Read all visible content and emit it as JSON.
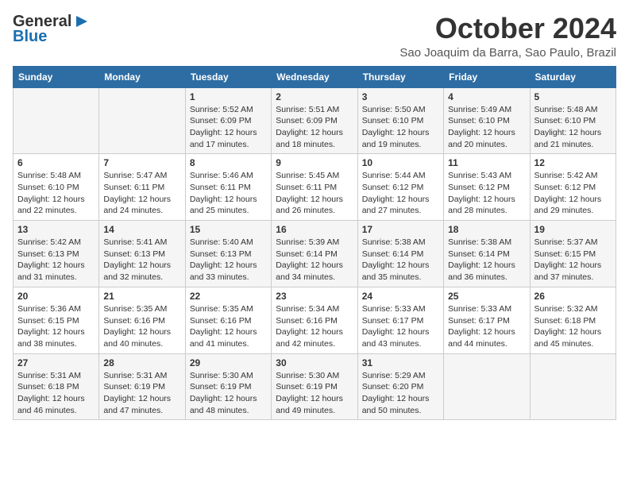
{
  "header": {
    "logo_line1": "General",
    "logo_line2": "Blue",
    "month_title": "October 2024",
    "location": "Sao Joaquim da Barra, Sao Paulo, Brazil"
  },
  "days_of_week": [
    "Sunday",
    "Monday",
    "Tuesday",
    "Wednesday",
    "Thursday",
    "Friday",
    "Saturday"
  ],
  "weeks": [
    [
      {
        "day": "",
        "sunrise": "",
        "sunset": "",
        "daylight": ""
      },
      {
        "day": "",
        "sunrise": "",
        "sunset": "",
        "daylight": ""
      },
      {
        "day": "1",
        "sunrise": "Sunrise: 5:52 AM",
        "sunset": "Sunset: 6:09 PM",
        "daylight": "Daylight: 12 hours and 17 minutes."
      },
      {
        "day": "2",
        "sunrise": "Sunrise: 5:51 AM",
        "sunset": "Sunset: 6:09 PM",
        "daylight": "Daylight: 12 hours and 18 minutes."
      },
      {
        "day": "3",
        "sunrise": "Sunrise: 5:50 AM",
        "sunset": "Sunset: 6:10 PM",
        "daylight": "Daylight: 12 hours and 19 minutes."
      },
      {
        "day": "4",
        "sunrise": "Sunrise: 5:49 AM",
        "sunset": "Sunset: 6:10 PM",
        "daylight": "Daylight: 12 hours and 20 minutes."
      },
      {
        "day": "5",
        "sunrise": "Sunrise: 5:48 AM",
        "sunset": "Sunset: 6:10 PM",
        "daylight": "Daylight: 12 hours and 21 minutes."
      }
    ],
    [
      {
        "day": "6",
        "sunrise": "Sunrise: 5:48 AM",
        "sunset": "Sunset: 6:10 PM",
        "daylight": "Daylight: 12 hours and 22 minutes."
      },
      {
        "day": "7",
        "sunrise": "Sunrise: 5:47 AM",
        "sunset": "Sunset: 6:11 PM",
        "daylight": "Daylight: 12 hours and 24 minutes."
      },
      {
        "day": "8",
        "sunrise": "Sunrise: 5:46 AM",
        "sunset": "Sunset: 6:11 PM",
        "daylight": "Daylight: 12 hours and 25 minutes."
      },
      {
        "day": "9",
        "sunrise": "Sunrise: 5:45 AM",
        "sunset": "Sunset: 6:11 PM",
        "daylight": "Daylight: 12 hours and 26 minutes."
      },
      {
        "day": "10",
        "sunrise": "Sunrise: 5:44 AM",
        "sunset": "Sunset: 6:12 PM",
        "daylight": "Daylight: 12 hours and 27 minutes."
      },
      {
        "day": "11",
        "sunrise": "Sunrise: 5:43 AM",
        "sunset": "Sunset: 6:12 PM",
        "daylight": "Daylight: 12 hours and 28 minutes."
      },
      {
        "day": "12",
        "sunrise": "Sunrise: 5:42 AM",
        "sunset": "Sunset: 6:12 PM",
        "daylight": "Daylight: 12 hours and 29 minutes."
      }
    ],
    [
      {
        "day": "13",
        "sunrise": "Sunrise: 5:42 AM",
        "sunset": "Sunset: 6:13 PM",
        "daylight": "Daylight: 12 hours and 31 minutes."
      },
      {
        "day": "14",
        "sunrise": "Sunrise: 5:41 AM",
        "sunset": "Sunset: 6:13 PM",
        "daylight": "Daylight: 12 hours and 32 minutes."
      },
      {
        "day": "15",
        "sunrise": "Sunrise: 5:40 AM",
        "sunset": "Sunset: 6:13 PM",
        "daylight": "Daylight: 12 hours and 33 minutes."
      },
      {
        "day": "16",
        "sunrise": "Sunrise: 5:39 AM",
        "sunset": "Sunset: 6:14 PM",
        "daylight": "Daylight: 12 hours and 34 minutes."
      },
      {
        "day": "17",
        "sunrise": "Sunrise: 5:38 AM",
        "sunset": "Sunset: 6:14 PM",
        "daylight": "Daylight: 12 hours and 35 minutes."
      },
      {
        "day": "18",
        "sunrise": "Sunrise: 5:38 AM",
        "sunset": "Sunset: 6:14 PM",
        "daylight": "Daylight: 12 hours and 36 minutes."
      },
      {
        "day": "19",
        "sunrise": "Sunrise: 5:37 AM",
        "sunset": "Sunset: 6:15 PM",
        "daylight": "Daylight: 12 hours and 37 minutes."
      }
    ],
    [
      {
        "day": "20",
        "sunrise": "Sunrise: 5:36 AM",
        "sunset": "Sunset: 6:15 PM",
        "daylight": "Daylight: 12 hours and 38 minutes."
      },
      {
        "day": "21",
        "sunrise": "Sunrise: 5:35 AM",
        "sunset": "Sunset: 6:16 PM",
        "daylight": "Daylight: 12 hours and 40 minutes."
      },
      {
        "day": "22",
        "sunrise": "Sunrise: 5:35 AM",
        "sunset": "Sunset: 6:16 PM",
        "daylight": "Daylight: 12 hours and 41 minutes."
      },
      {
        "day": "23",
        "sunrise": "Sunrise: 5:34 AM",
        "sunset": "Sunset: 6:16 PM",
        "daylight": "Daylight: 12 hours and 42 minutes."
      },
      {
        "day": "24",
        "sunrise": "Sunrise: 5:33 AM",
        "sunset": "Sunset: 6:17 PM",
        "daylight": "Daylight: 12 hours and 43 minutes."
      },
      {
        "day": "25",
        "sunrise": "Sunrise: 5:33 AM",
        "sunset": "Sunset: 6:17 PM",
        "daylight": "Daylight: 12 hours and 44 minutes."
      },
      {
        "day": "26",
        "sunrise": "Sunrise: 5:32 AM",
        "sunset": "Sunset: 6:18 PM",
        "daylight": "Daylight: 12 hours and 45 minutes."
      }
    ],
    [
      {
        "day": "27",
        "sunrise": "Sunrise: 5:31 AM",
        "sunset": "Sunset: 6:18 PM",
        "daylight": "Daylight: 12 hours and 46 minutes."
      },
      {
        "day": "28",
        "sunrise": "Sunrise: 5:31 AM",
        "sunset": "Sunset: 6:19 PM",
        "daylight": "Daylight: 12 hours and 47 minutes."
      },
      {
        "day": "29",
        "sunrise": "Sunrise: 5:30 AM",
        "sunset": "Sunset: 6:19 PM",
        "daylight": "Daylight: 12 hours and 48 minutes."
      },
      {
        "day": "30",
        "sunrise": "Sunrise: 5:30 AM",
        "sunset": "Sunset: 6:19 PM",
        "daylight": "Daylight: 12 hours and 49 minutes."
      },
      {
        "day": "31",
        "sunrise": "Sunrise: 5:29 AM",
        "sunset": "Sunset: 6:20 PM",
        "daylight": "Daylight: 12 hours and 50 minutes."
      },
      {
        "day": "",
        "sunrise": "",
        "sunset": "",
        "daylight": ""
      },
      {
        "day": "",
        "sunrise": "",
        "sunset": "",
        "daylight": ""
      }
    ]
  ]
}
